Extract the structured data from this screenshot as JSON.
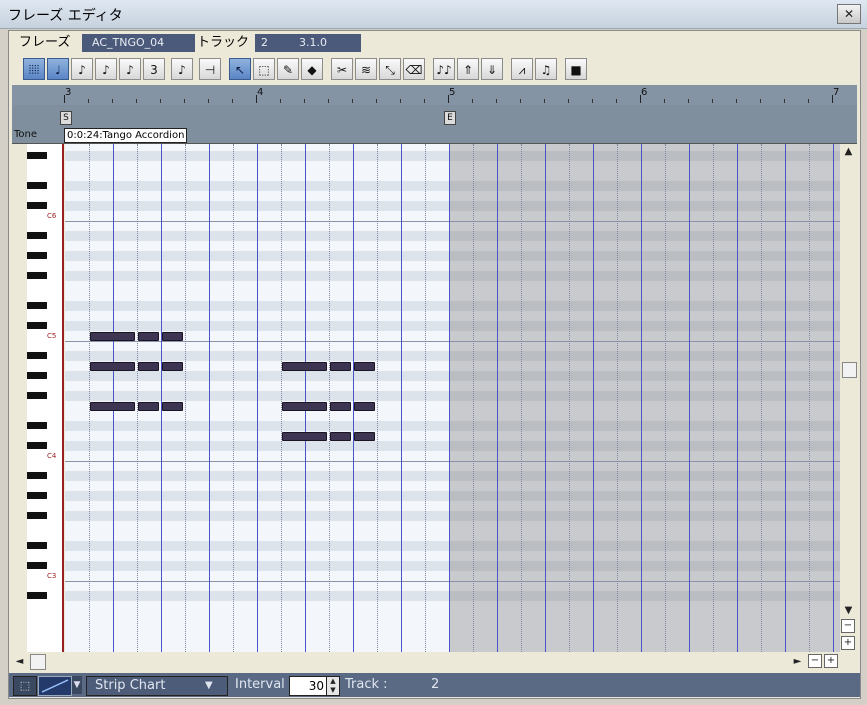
{
  "window": {
    "title": "フレーズ エディタ",
    "close_glyph": "✕"
  },
  "header": {
    "phrase_label": "フレーズ",
    "phrase_value": "AC_TNGO_04",
    "track_label": "トラック",
    "track_number": "2",
    "track_time": "3.1.0"
  },
  "toolbar": {
    "buttons": [
      {
        "icon": "grid-icon",
        "glyph": "⦙⦙⦙⦙"
      },
      {
        "icon": "quarter-note-icon",
        "glyph": "♩"
      },
      {
        "icon": "eighth-note-icon",
        "glyph": "♪"
      },
      {
        "icon": "sixteenth-note-icon",
        "glyph": "♪"
      },
      {
        "icon": "thirtysecond-note-icon",
        "glyph": "♪"
      },
      {
        "icon": "triplet-icon",
        "glyph": "3"
      },
      {
        "icon": "dotted-note-icon",
        "glyph": "♪"
      },
      {
        "icon": "tie-icon",
        "glyph": "⊣"
      },
      {
        "icon": "pointer-icon",
        "glyph": "↖"
      },
      {
        "icon": "select-range-icon",
        "glyph": "⬚"
      },
      {
        "icon": "pencil-note-icon",
        "glyph": "✎"
      },
      {
        "icon": "paint-icon",
        "glyph": "◆"
      },
      {
        "icon": "cut-icon",
        "glyph": "✂"
      },
      {
        "icon": "glue-icon",
        "glyph": "≋"
      },
      {
        "icon": "resize-icon",
        "glyph": "⤡"
      },
      {
        "icon": "eraser-icon",
        "glyph": "⌫"
      },
      {
        "icon": "quantize-icon",
        "glyph": "♪♪"
      },
      {
        "icon": "transpose-up-icon",
        "glyph": "⇑"
      },
      {
        "icon": "transpose-down-icon",
        "glyph": "⇓"
      },
      {
        "icon": "arpeggio-icon",
        "glyph": "⩘"
      },
      {
        "icon": "play-note-icon",
        "glyph": "♫"
      },
      {
        "icon": "stop-icon",
        "glyph": "■"
      }
    ]
  },
  "ruler": {
    "measures": [
      "3",
      "4",
      "5",
      "6",
      "7"
    ]
  },
  "markers": {
    "start": "S",
    "end": "E"
  },
  "tone": {
    "label": "Tone",
    "value": "0:0:24:Tango Accordion"
  },
  "piano": {
    "octaves": [
      "C6",
      "C5",
      "C4",
      "C3"
    ]
  },
  "notes": [
    {
      "measure": 3,
      "beat": 1.5,
      "length": 1,
      "pitch": "C5"
    },
    {
      "measure": 3,
      "beat": 2.5,
      "length": 0.5,
      "pitch": "C5"
    },
    {
      "measure": 3,
      "beat": 3,
      "length": 0.5,
      "pitch": "C5"
    },
    {
      "measure": 3,
      "beat": 1.5,
      "length": 1,
      "pitch": "A4"
    },
    {
      "measure": 3,
      "beat": 2.5,
      "length": 0.5,
      "pitch": "A4"
    },
    {
      "measure": 3,
      "beat": 3,
      "length": 0.5,
      "pitch": "A4"
    },
    {
      "measure": 3,
      "beat": 1.5,
      "length": 1,
      "pitch": "F4"
    },
    {
      "measure": 3,
      "beat": 2.5,
      "length": 0.5,
      "pitch": "F4"
    },
    {
      "measure": 3,
      "beat": 3,
      "length": 0.5,
      "pitch": "F4"
    },
    {
      "measure": 4,
      "beat": 1.5,
      "length": 1,
      "pitch": "A4"
    },
    {
      "measure": 4,
      "beat": 2.5,
      "length": 0.5,
      "pitch": "A4"
    },
    {
      "measure": 4,
      "beat": 3,
      "length": 0.5,
      "pitch": "A4"
    },
    {
      "measure": 4,
      "beat": 1.5,
      "length": 1,
      "pitch": "F4"
    },
    {
      "measure": 4,
      "beat": 2.5,
      "length": 0.5,
      "pitch": "F4"
    },
    {
      "measure": 4,
      "beat": 3,
      "length": 0.5,
      "pitch": "F4"
    },
    {
      "measure": 4,
      "beat": 1.5,
      "length": 1,
      "pitch": "D4"
    },
    {
      "measure": 4,
      "beat": 2.5,
      "length": 0.5,
      "pitch": "D4"
    },
    {
      "measure": 4,
      "beat": 3,
      "length": 0.5,
      "pitch": "D4"
    }
  ],
  "scroll": {
    "up": "▲",
    "down": "▼",
    "left": "◄",
    "right": "►",
    "zoom_out": "−",
    "zoom_in": "+"
  },
  "footer": {
    "view_type": "Strip Chart",
    "interval_label": "Interval",
    "interval_value": "30",
    "track_label": "Track :",
    "track_value": "2"
  }
}
